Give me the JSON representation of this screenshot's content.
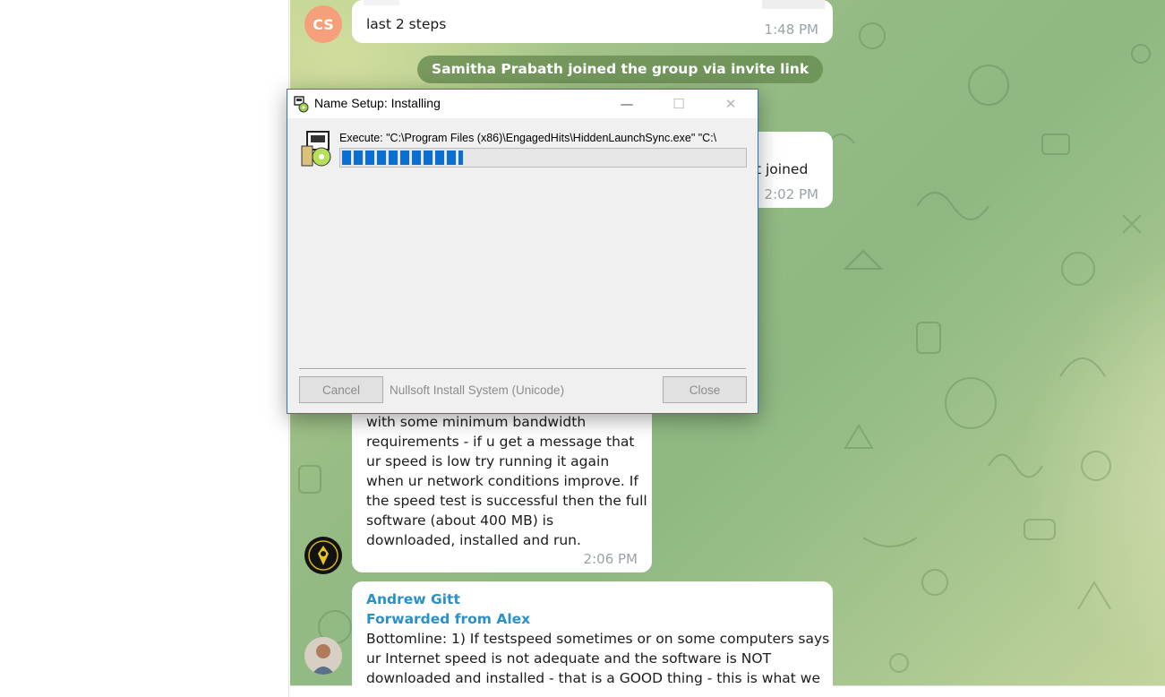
{
  "messages": {
    "m1": {
      "avatar_initials": "CS",
      "text": "last 2 steps",
      "time": "1:48 PM"
    },
    "service": {
      "text": "Samitha Prabath joined the group via invite link"
    },
    "m2": {
      "text": "t joined",
      "time": "2:02 PM"
    },
    "m3": {
      "lines": [
        "with some minimum bandwidth",
        "requirements - if u get a message that",
        "ur speed is low try running it again",
        "when ur network conditions improve. If",
        "the speed test is successful then the full",
        "software (about 400 MB)  is",
        "downloaded, installed and run."
      ],
      "time": "2:06 PM"
    },
    "m4": {
      "author": "Andrew Gitt",
      "forwarded": "Forwarded from Alex",
      "lines": [
        "Bottomline: 1) If testspeed sometimes or on some computers says",
        "ur Internet speed is not adequate and the software is NOT",
        "downloaded and installed - that is a GOOD thing - this is what we"
      ]
    }
  },
  "installer": {
    "title": "Name Setup: Installing",
    "execute_text": "Execute: \"C:\\Program Files (x86)\\EngagedHits\\HiddenLaunchSync.exe\" \"C:\\",
    "progress_fraction": 0.3,
    "cancel_label": "Cancel",
    "branding": "Nullsoft Install System (Unicode)",
    "close_label": "Close",
    "minimize_glyph": "—",
    "maximize_glyph": "☐",
    "close_glyph": "✕"
  },
  "colors": {
    "author": "#2a91c8",
    "progress": "#0a6fd0",
    "service_pill": "#688c52",
    "avatar_cs": "#f5a07a"
  }
}
